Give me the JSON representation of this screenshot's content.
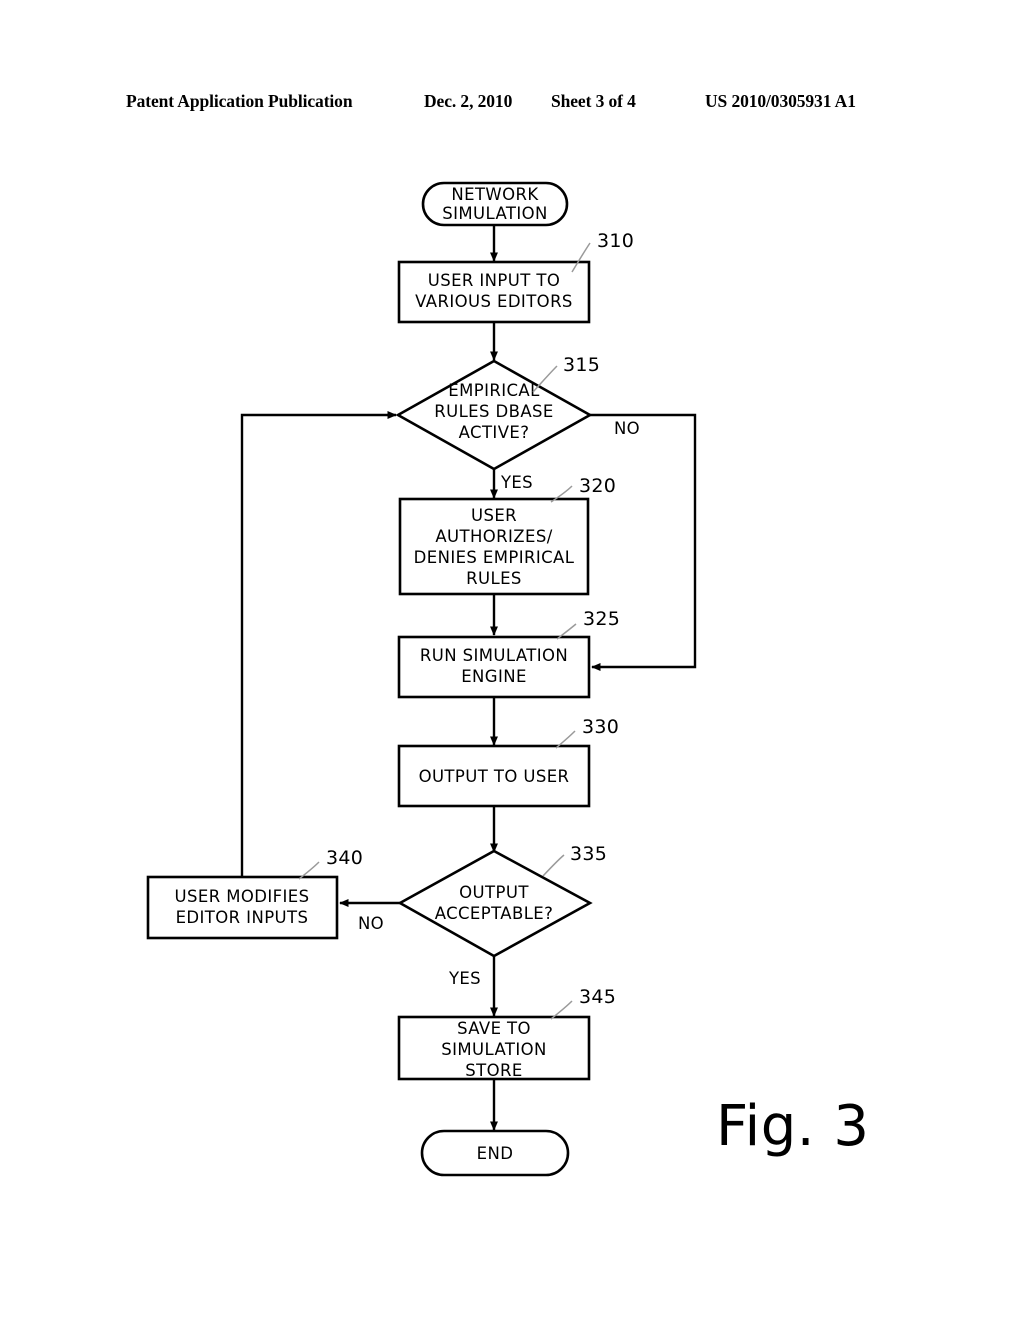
{
  "header": {
    "publication": "Patent Application Publication",
    "date": "Dec. 2, 2010",
    "sheet": "Sheet 3 of 4",
    "patent_number": "US 2010/0305931 A1"
  },
  "figure": {
    "label": "Fig. 3"
  },
  "flowchart": {
    "nodes": [
      {
        "id": "start",
        "type": "terminator",
        "lines": [
          "NETWORK",
          "SIMULATION"
        ],
        "ref": ""
      },
      {
        "id": "n310",
        "type": "process",
        "lines": [
          "USER INPUT TO",
          "VARIOUS EDITORS"
        ],
        "ref": "310"
      },
      {
        "id": "n315",
        "type": "decision",
        "lines": [
          "EMPIRICAL",
          "RULES DBASE",
          "ACTIVE?"
        ],
        "ref": "315"
      },
      {
        "id": "n320",
        "type": "process",
        "lines": [
          "USER",
          "AUTHORIZES/",
          "DENIES EMPIRICAL",
          "RULES"
        ],
        "ref": "320"
      },
      {
        "id": "n325",
        "type": "process",
        "lines": [
          "RUN SIMULATION",
          "ENGINE"
        ],
        "ref": "325"
      },
      {
        "id": "n330",
        "type": "process",
        "lines": [
          "OUTPUT TO USER"
        ],
        "ref": "330"
      },
      {
        "id": "n335",
        "type": "decision",
        "lines": [
          "OUTPUT",
          "ACCEPTABLE?"
        ],
        "ref": "335"
      },
      {
        "id": "n340",
        "type": "process",
        "lines": [
          "USER MODIFIES",
          "EDITOR INPUTS"
        ],
        "ref": "340"
      },
      {
        "id": "n345",
        "type": "process",
        "lines": [
          "SAVE TO",
          "SIMULATION",
          "STORE"
        ],
        "ref": "345"
      },
      {
        "id": "end",
        "type": "terminator",
        "lines": [
          "END"
        ],
        "ref": ""
      }
    ],
    "branch_labels": {
      "d315_no": "NO",
      "d315_yes": "YES",
      "d335_no": "NO",
      "d335_yes": "YES"
    }
  }
}
